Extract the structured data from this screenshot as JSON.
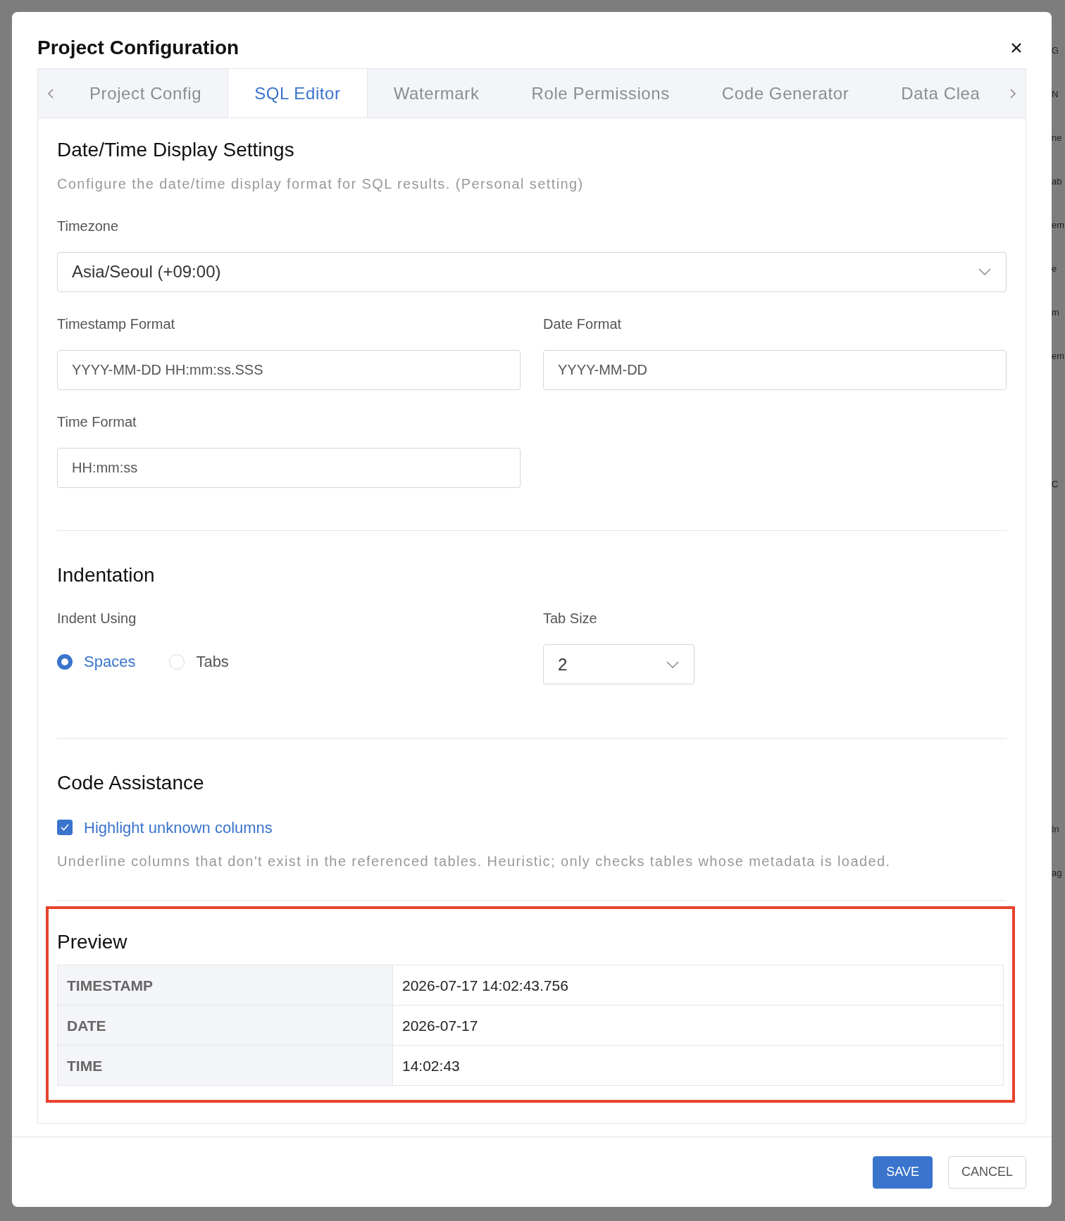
{
  "background_fragments": [
    "G",
    "N",
    "ne",
    "ab",
    "em",
    "e",
    "m",
    "em",
    "C",
    "In",
    "ag"
  ],
  "dialog": {
    "title": "Project Configuration",
    "tabs": [
      {
        "label": "Project Config",
        "selected": false
      },
      {
        "label": "SQL Editor",
        "selected": true
      },
      {
        "label": "Watermark",
        "selected": false
      },
      {
        "label": "Role Permissions",
        "selected": false
      },
      {
        "label": "Code Generator",
        "selected": false
      },
      {
        "label": "Data Clea",
        "selected": false
      }
    ],
    "datetime": {
      "heading": "Date/Time Display Settings",
      "description": "Configure the date/time display format for SQL results. (Personal setting)",
      "timezone": {
        "label": "Timezone",
        "value": "Asia/Seoul (+09:00)"
      },
      "timestamp_format": {
        "label": "Timestamp Format",
        "value": "YYYY-MM-DD HH:mm:ss.SSS"
      },
      "date_format": {
        "label": "Date Format",
        "value": "YYYY-MM-DD"
      },
      "time_format": {
        "label": "Time Format",
        "value": "HH:mm:ss"
      }
    },
    "indentation": {
      "heading": "Indentation",
      "indent_label": "Indent Using",
      "options": [
        {
          "label": "Spaces",
          "selected": true
        },
        {
          "label": "Tabs",
          "selected": false
        }
      ],
      "tab_size": {
        "label": "Tab Size",
        "value": "2"
      }
    },
    "code_assistance": {
      "heading": "Code Assistance",
      "checkbox": {
        "label": "Highlight unknown columns",
        "checked": true
      },
      "description": "Underline columns that don't exist in the referenced tables. Heuristic; only checks tables whose metadata is loaded."
    },
    "preview": {
      "heading": "Preview",
      "highlighted": true,
      "rows": [
        {
          "name": "TIMESTAMP",
          "value": "2026-07-17 14:02:43.756"
        },
        {
          "name": "DATE",
          "value": "2026-07-17"
        },
        {
          "name": "TIME",
          "value": "14:02:43"
        }
      ]
    },
    "buttons": [
      {
        "label": "SAVE",
        "kind": "primary"
      },
      {
        "label": "CANCEL",
        "kind": "secondary"
      }
    ]
  }
}
